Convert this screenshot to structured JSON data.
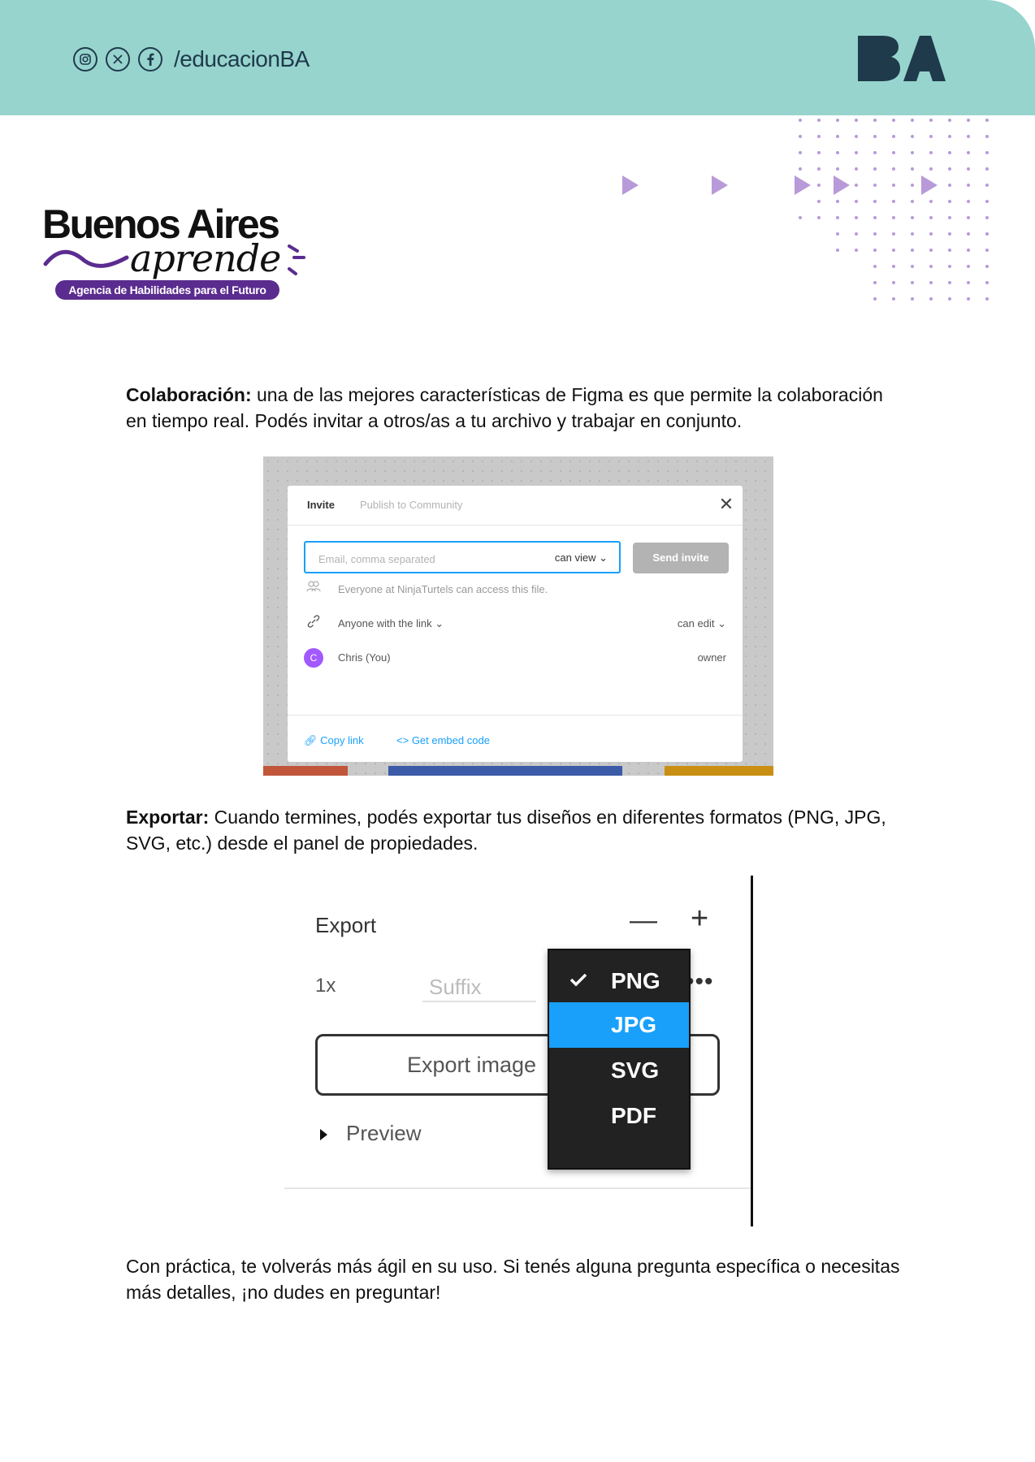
{
  "header": {
    "social_icons": [
      "instagram-icon",
      "x-icon",
      "facebook-icon"
    ],
    "handle": "/educacionBA",
    "logo_text": "BA",
    "bg_color": "#97d4ce"
  },
  "brand": {
    "title": "Buenos Aires",
    "script": "aprende",
    "tagline": "Agencia de Habilidades para el Futuro",
    "accent_color": "#5b2c8f"
  },
  "sections": {
    "collab": {
      "bold": "Colaboración:",
      "text": " una de las mejores características de Figma es que permite la colaboración en tiempo real. Podés invitar a otros/as a tu archivo y trabajar en conjunto."
    },
    "export": {
      "bold": "Exportar:",
      "text": " Cuando termines, podés exportar tus diseños en diferentes formatos (PNG, JPG, SVG, etc.) desde el panel de propiedades."
    },
    "closing": {
      "text": "Con práctica, te volverás más ágil en su uso. Si tenés alguna pregunta específica o necesitas más detalles, ¡no dudes en preguntar!"
    }
  },
  "invite_dialog": {
    "tab_active": "Invite",
    "tab_inactive": "Publish to Community",
    "email_placeholder": "Email, comma separated",
    "permission": "can view",
    "send_button": "Send invite",
    "team_access": "Everyone at NinjaTurtels can access this file.",
    "link_access": "Anyone with the link",
    "link_permission": "can edit",
    "user_initial": "C",
    "user_name": "Chris (You)",
    "user_role": "owner",
    "copy_link": "Copy link",
    "embed_code": "Get embed code",
    "accent_color": "#18a0fb"
  },
  "export_panel": {
    "title": "Export",
    "scale": "1x",
    "suffix_placeholder": "Suffix",
    "export_button": "Export image",
    "preview": "Preview",
    "formats": [
      "PNG",
      "JPG",
      "SVG",
      "PDF"
    ],
    "checked_format": "PNG",
    "highlighted_format": "JPG"
  }
}
